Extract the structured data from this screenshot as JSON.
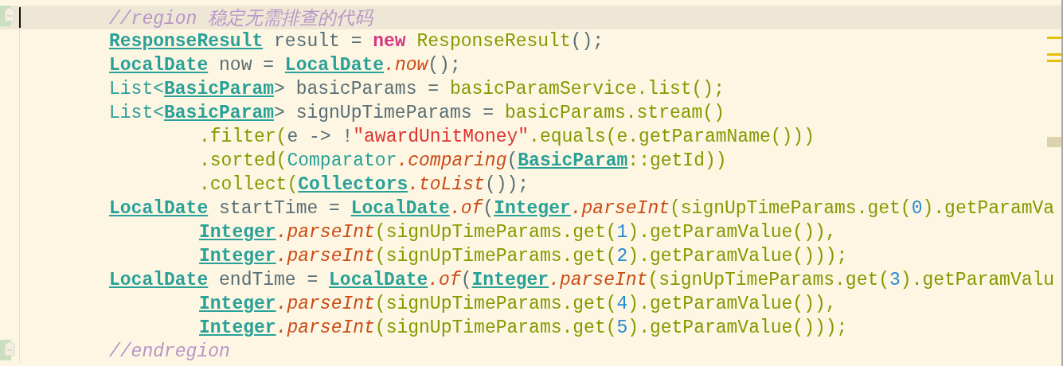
{
  "editor": {
    "lines": [
      {
        "kind": "statement",
        "current": true,
        "fold_marker": true,
        "tokens": [
          {
            "kind": "comment",
            "text": "//region 稳定无需排查的代码"
          }
        ]
      },
      {
        "kind": "statement",
        "current": false,
        "fold_marker": false,
        "tokens": [
          {
            "kind": "type",
            "text": "ResponseResult"
          },
          {
            "kind": "plain",
            "text": " result = "
          },
          {
            "kind": "keyword",
            "text": "new"
          },
          {
            "kind": "call",
            "text": " ResponseResult"
          },
          {
            "kind": "plain",
            "text": "();"
          }
        ]
      },
      {
        "kind": "statement",
        "current": false,
        "fold_marker": false,
        "tokens": [
          {
            "kind": "type",
            "text": "LocalDate"
          },
          {
            "kind": "plain",
            "text": " now = "
          },
          {
            "kind": "type",
            "text": "LocalDate"
          },
          {
            "kind": "method",
            "text": ".now"
          },
          {
            "kind": "plain",
            "text": "();"
          }
        ]
      },
      {
        "kind": "statement",
        "current": false,
        "fold_marker": false,
        "tokens": [
          {
            "kind": "class",
            "text": "List<"
          },
          {
            "kind": "type",
            "text": "BasicParam"
          },
          {
            "kind": "plain",
            "text": "> basicParams = "
          },
          {
            "kind": "call",
            "text": "basicParamService.list();"
          }
        ]
      },
      {
        "kind": "statement",
        "current": false,
        "fold_marker": false,
        "tokens": [
          {
            "kind": "class",
            "text": "List<"
          },
          {
            "kind": "type",
            "text": "BasicParam"
          },
          {
            "kind": "plain",
            "text": "> signUpTimeParams = "
          },
          {
            "kind": "call",
            "text": "basicParams.stream()"
          }
        ]
      },
      {
        "kind": "continuation",
        "current": false,
        "fold_marker": false,
        "tokens": [
          {
            "kind": "call",
            "text": ".filter("
          },
          {
            "kind": "plain",
            "text": "e -> !"
          },
          {
            "kind": "string",
            "text": "\"awardUnitMoney\""
          },
          {
            "kind": "call",
            "text": ".equals(e.getParamName()))"
          }
        ]
      },
      {
        "kind": "continuation",
        "current": false,
        "fold_marker": false,
        "tokens": [
          {
            "kind": "call",
            "text": ".sorted("
          },
          {
            "kind": "class",
            "text": "Comparator"
          },
          {
            "kind": "method",
            "text": ".comparing"
          },
          {
            "kind": "plain",
            "text": "("
          },
          {
            "kind": "type",
            "text": "BasicParam"
          },
          {
            "kind": "call",
            "text": "::getId))"
          }
        ]
      },
      {
        "kind": "continuation",
        "current": false,
        "fold_marker": false,
        "tokens": [
          {
            "kind": "call",
            "text": ".collect("
          },
          {
            "kind": "type",
            "text": "Collectors"
          },
          {
            "kind": "method",
            "text": ".toList"
          },
          {
            "kind": "plain",
            "text": "());"
          }
        ]
      },
      {
        "kind": "statement",
        "current": false,
        "fold_marker": false,
        "tokens": [
          {
            "kind": "type",
            "text": "LocalDate"
          },
          {
            "kind": "plain",
            "text": " startTime = "
          },
          {
            "kind": "type",
            "text": "LocalDate"
          },
          {
            "kind": "method",
            "text": ".of"
          },
          {
            "kind": "plain",
            "text": "("
          },
          {
            "kind": "type",
            "text": "Integer"
          },
          {
            "kind": "method",
            "text": ".parseInt"
          },
          {
            "kind": "call",
            "text": "(signUpTimeParams.get("
          },
          {
            "kind": "number",
            "text": "0"
          },
          {
            "kind": "call",
            "text": ").getParamVa"
          }
        ]
      },
      {
        "kind": "continuation",
        "current": false,
        "fold_marker": false,
        "tokens": [
          {
            "kind": "type",
            "text": "Integer"
          },
          {
            "kind": "method",
            "text": ".parseInt"
          },
          {
            "kind": "call",
            "text": "(signUpTimeParams.get("
          },
          {
            "kind": "number",
            "text": "1"
          },
          {
            "kind": "call",
            "text": ").getParamValue()),"
          }
        ]
      },
      {
        "kind": "continuation",
        "current": false,
        "fold_marker": false,
        "tokens": [
          {
            "kind": "type",
            "text": "Integer"
          },
          {
            "kind": "method",
            "text": ".parseInt"
          },
          {
            "kind": "call",
            "text": "(signUpTimeParams.get("
          },
          {
            "kind": "number",
            "text": "2"
          },
          {
            "kind": "call",
            "text": ").getParamValue()));"
          }
        ]
      },
      {
        "kind": "statement",
        "current": false,
        "fold_marker": false,
        "tokens": [
          {
            "kind": "type",
            "text": "LocalDate"
          },
          {
            "kind": "plain",
            "text": " endTime = "
          },
          {
            "kind": "type",
            "text": "LocalDate"
          },
          {
            "kind": "method",
            "text": ".of"
          },
          {
            "kind": "plain",
            "text": "("
          },
          {
            "kind": "type",
            "text": "Integer"
          },
          {
            "kind": "method",
            "text": ".parseInt"
          },
          {
            "kind": "call",
            "text": "(signUpTimeParams.get("
          },
          {
            "kind": "number",
            "text": "3"
          },
          {
            "kind": "call",
            "text": ").getParamValu"
          }
        ]
      },
      {
        "kind": "continuation",
        "current": false,
        "fold_marker": false,
        "tokens": [
          {
            "kind": "type",
            "text": "Integer"
          },
          {
            "kind": "method",
            "text": ".parseInt"
          },
          {
            "kind": "call",
            "text": "(signUpTimeParams.get("
          },
          {
            "kind": "number",
            "text": "4"
          },
          {
            "kind": "call",
            "text": ").getParamValue()),"
          }
        ]
      },
      {
        "kind": "continuation",
        "current": false,
        "fold_marker": false,
        "tokens": [
          {
            "kind": "type",
            "text": "Integer"
          },
          {
            "kind": "method",
            "text": ".parseInt"
          },
          {
            "kind": "call",
            "text": "(signUpTimeParams.get("
          },
          {
            "kind": "number",
            "text": "5"
          },
          {
            "kind": "call",
            "text": ").getParamValue()));"
          }
        ]
      },
      {
        "kind": "statement",
        "current": false,
        "fold_marker": true,
        "tokens": [
          {
            "kind": "comment",
            "text": "//endregion"
          }
        ]
      }
    ]
  }
}
